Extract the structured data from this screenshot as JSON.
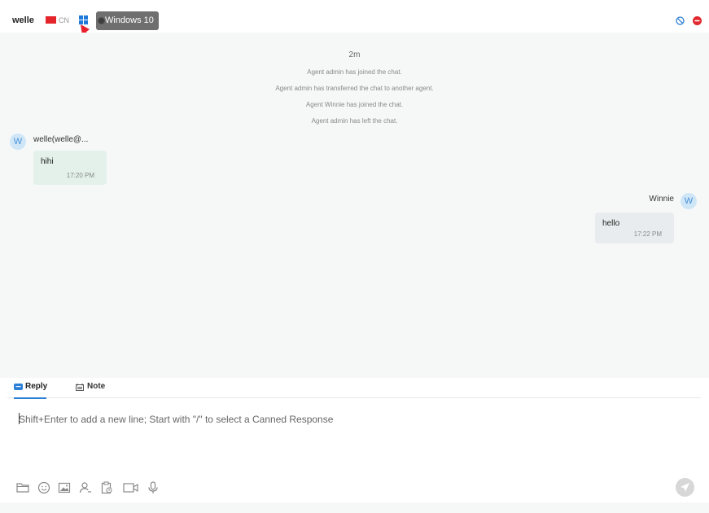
{
  "header": {
    "visitor_name": "welle",
    "country": "CN",
    "os_icon": "windows-icon",
    "os_tooltip": "Windows 10"
  },
  "chat": {
    "time_separator": "2m",
    "system_messages": [
      "Agent admin has joined the chat.",
      "Agent admin has transferred the chat to another agent.",
      "Agent Winnie has joined the chat.",
      "Agent admin has left the chat."
    ],
    "messages": [
      {
        "side": "left",
        "avatar": "W",
        "sender": "welle(welle@...",
        "text": "hihi",
        "time": "17:20 PM",
        "bubble_color": "#e3f1ea"
      },
      {
        "side": "right",
        "avatar": "W",
        "sender": "Winnie",
        "text": "hello",
        "time": "17:22 PM",
        "bubble_color": "#e9ecee"
      }
    ]
  },
  "composer": {
    "tabs": [
      {
        "label": "Reply",
        "active": true
      },
      {
        "label": "Note",
        "active": false
      }
    ],
    "placeholder": "Shift+Enter to add a new line; Start with \"/\" to select a Canned Response",
    "tools": [
      "folder-icon",
      "emoji-icon",
      "image-icon",
      "contact-icon",
      "clipboard-icon",
      "video-icon",
      "microphone-icon"
    ],
    "send_icon": "send-icon"
  },
  "colors": {
    "accent": "#2b7fd6",
    "annotation_arrow": "#e8202a",
    "ban": "#2b7fd6",
    "stop": "#e0282e"
  }
}
